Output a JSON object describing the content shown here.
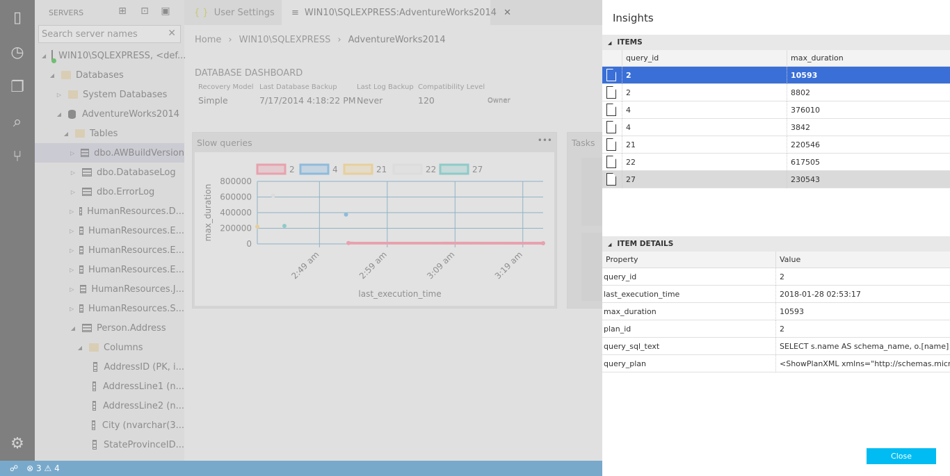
{
  "sidebar": {
    "title": "SERVERS",
    "search_placeholder": "Search server names",
    "tree": [
      {
        "label": "WIN10\\SQLEXPRESS, <def...",
        "icon": "server",
        "level": 0,
        "expanded": true
      },
      {
        "label": "Databases",
        "icon": "folder",
        "level": 1,
        "expanded": true
      },
      {
        "label": "System Databases",
        "icon": "folder",
        "level": 2,
        "expanded": false
      },
      {
        "label": "AdventureWorks2014",
        "icon": "database",
        "level": 2,
        "expanded": true
      },
      {
        "label": "Tables",
        "icon": "folder",
        "level": 3,
        "expanded": true
      },
      {
        "label": "dbo.AWBuildVersion",
        "icon": "table",
        "level": 4,
        "expanded": false,
        "selected": true
      },
      {
        "label": "dbo.DatabaseLog",
        "icon": "table",
        "level": 4,
        "expanded": false
      },
      {
        "label": "dbo.ErrorLog",
        "icon": "table",
        "level": 4,
        "expanded": false
      },
      {
        "label": "HumanResources.D...",
        "icon": "table",
        "level": 4,
        "expanded": false
      },
      {
        "label": "HumanResources.E...",
        "icon": "table",
        "level": 4,
        "expanded": false
      },
      {
        "label": "HumanResources.E...",
        "icon": "table",
        "level": 4,
        "expanded": false
      },
      {
        "label": "HumanResources.E...",
        "icon": "table",
        "level": 4,
        "expanded": false
      },
      {
        "label": "HumanResources.J...",
        "icon": "table",
        "level": 4,
        "expanded": false
      },
      {
        "label": "HumanResources.S...",
        "icon": "table",
        "level": 4,
        "expanded": false
      },
      {
        "label": "Person.Address",
        "icon": "table",
        "level": 4,
        "expanded": true
      },
      {
        "label": "Columns",
        "icon": "folder",
        "level": 5,
        "expanded": true
      },
      {
        "label": "AddressID (PK, i...",
        "icon": "column",
        "level": 6
      },
      {
        "label": "AddressLine1 (n...",
        "icon": "column",
        "level": 6
      },
      {
        "label": "AddressLine2 (n...",
        "icon": "column",
        "level": 6
      },
      {
        "label": "City (nvarchar(3...",
        "icon": "column",
        "level": 6
      },
      {
        "label": "StateProvinceID...",
        "icon": "column",
        "level": 6
      }
    ]
  },
  "tabs": [
    {
      "label": "User Settings",
      "icon": "{ }"
    },
    {
      "label": "WIN10\\SQLEXPRESS:AdventureWorks2014",
      "icon": "≡",
      "close": "✕"
    }
  ],
  "breadcrumb": [
    "Home",
    "WIN10\\SQLEXPRESS",
    "AdventureWorks2014"
  ],
  "dashboard": {
    "title": "DATABASE DASHBOARD",
    "props": [
      {
        "label": "Recovery Model",
        "value": "Simple"
      },
      {
        "label": "Last Database Backup",
        "value": "7/17/2014 4:18:22 PM"
      },
      {
        "label": "Last Log Backup",
        "value": "Never"
      },
      {
        "label": "Compatibility Level",
        "value": "120"
      },
      {
        "label": "Owner",
        "value": ""
      }
    ],
    "widgets": {
      "slow_queries": "Slow queries",
      "more": "•••",
      "tasks": "Tasks"
    }
  },
  "chart_data": {
    "type": "scatter",
    "title": "Slow queries",
    "xlabel": "last_execution_time",
    "ylabel": "max_duration",
    "ylim": [
      0,
      800000
    ],
    "yticks": [
      "0",
      "200000",
      "400000",
      "600000",
      "800000"
    ],
    "xlim": [
      "02:39:50",
      "03:22:00"
    ],
    "xticks": [
      {
        "t": "02:49:00",
        "label": "2:49 am"
      },
      {
        "t": "02:59:00",
        "label": "2:59 am"
      },
      {
        "t": "03:09:00",
        "label": "3:09 am"
      },
      {
        "t": "03:19:00",
        "label": "3:19 am"
      }
    ],
    "legend_position": "top",
    "series": [
      {
        "name": "2",
        "color": "#e8a1ae",
        "points": [
          [
            "02:53:17",
            10593
          ],
          [
            "03:22:00",
            8802
          ]
        ]
      },
      {
        "name": "4",
        "color": "#8fbbdc",
        "points": [
          [
            "02:52:55",
            376010
          ]
        ]
      },
      {
        "name": "21",
        "color": "#e7cf9c",
        "points": [
          [
            "02:39:50",
            220546
          ]
        ]
      },
      {
        "name": "22",
        "color": "#dcdcdc",
        "points": [
          [
            "02:42:10",
            617505
          ]
        ]
      },
      {
        "name": "27",
        "color": "#8fcac8",
        "points": [
          [
            "02:43:50",
            230543
          ]
        ]
      }
    ]
  },
  "insights": {
    "title": "Insights",
    "items_label": "ITEMS",
    "columns": [
      "query_id",
      "max_duration"
    ],
    "rows": [
      [
        "2",
        "10593"
      ],
      [
        "2",
        "8802"
      ],
      [
        "4",
        "376010"
      ],
      [
        "4",
        "3842"
      ],
      [
        "21",
        "220546"
      ],
      [
        "22",
        "617505"
      ],
      [
        "27",
        "230543"
      ]
    ],
    "details_label": "ITEM DETAILS",
    "detail_columns": [
      "Property",
      "Value"
    ],
    "details": [
      [
        "query_id",
        "2"
      ],
      [
        "last_execution_time",
        "2018-01-28 02:53:17"
      ],
      [
        "max_duration",
        "10593"
      ],
      [
        "plan_id",
        "2"
      ],
      [
        "query_sql_text",
        "SELECT s.name AS schema_name, o.[name] AS ob..."
      ],
      [
        "query_plan",
        "<ShowPlanXML xmlns=\"http://schemas.microsof..."
      ]
    ],
    "close_label": "Close"
  },
  "status": {
    "errors": "3",
    "warnings": "4"
  }
}
